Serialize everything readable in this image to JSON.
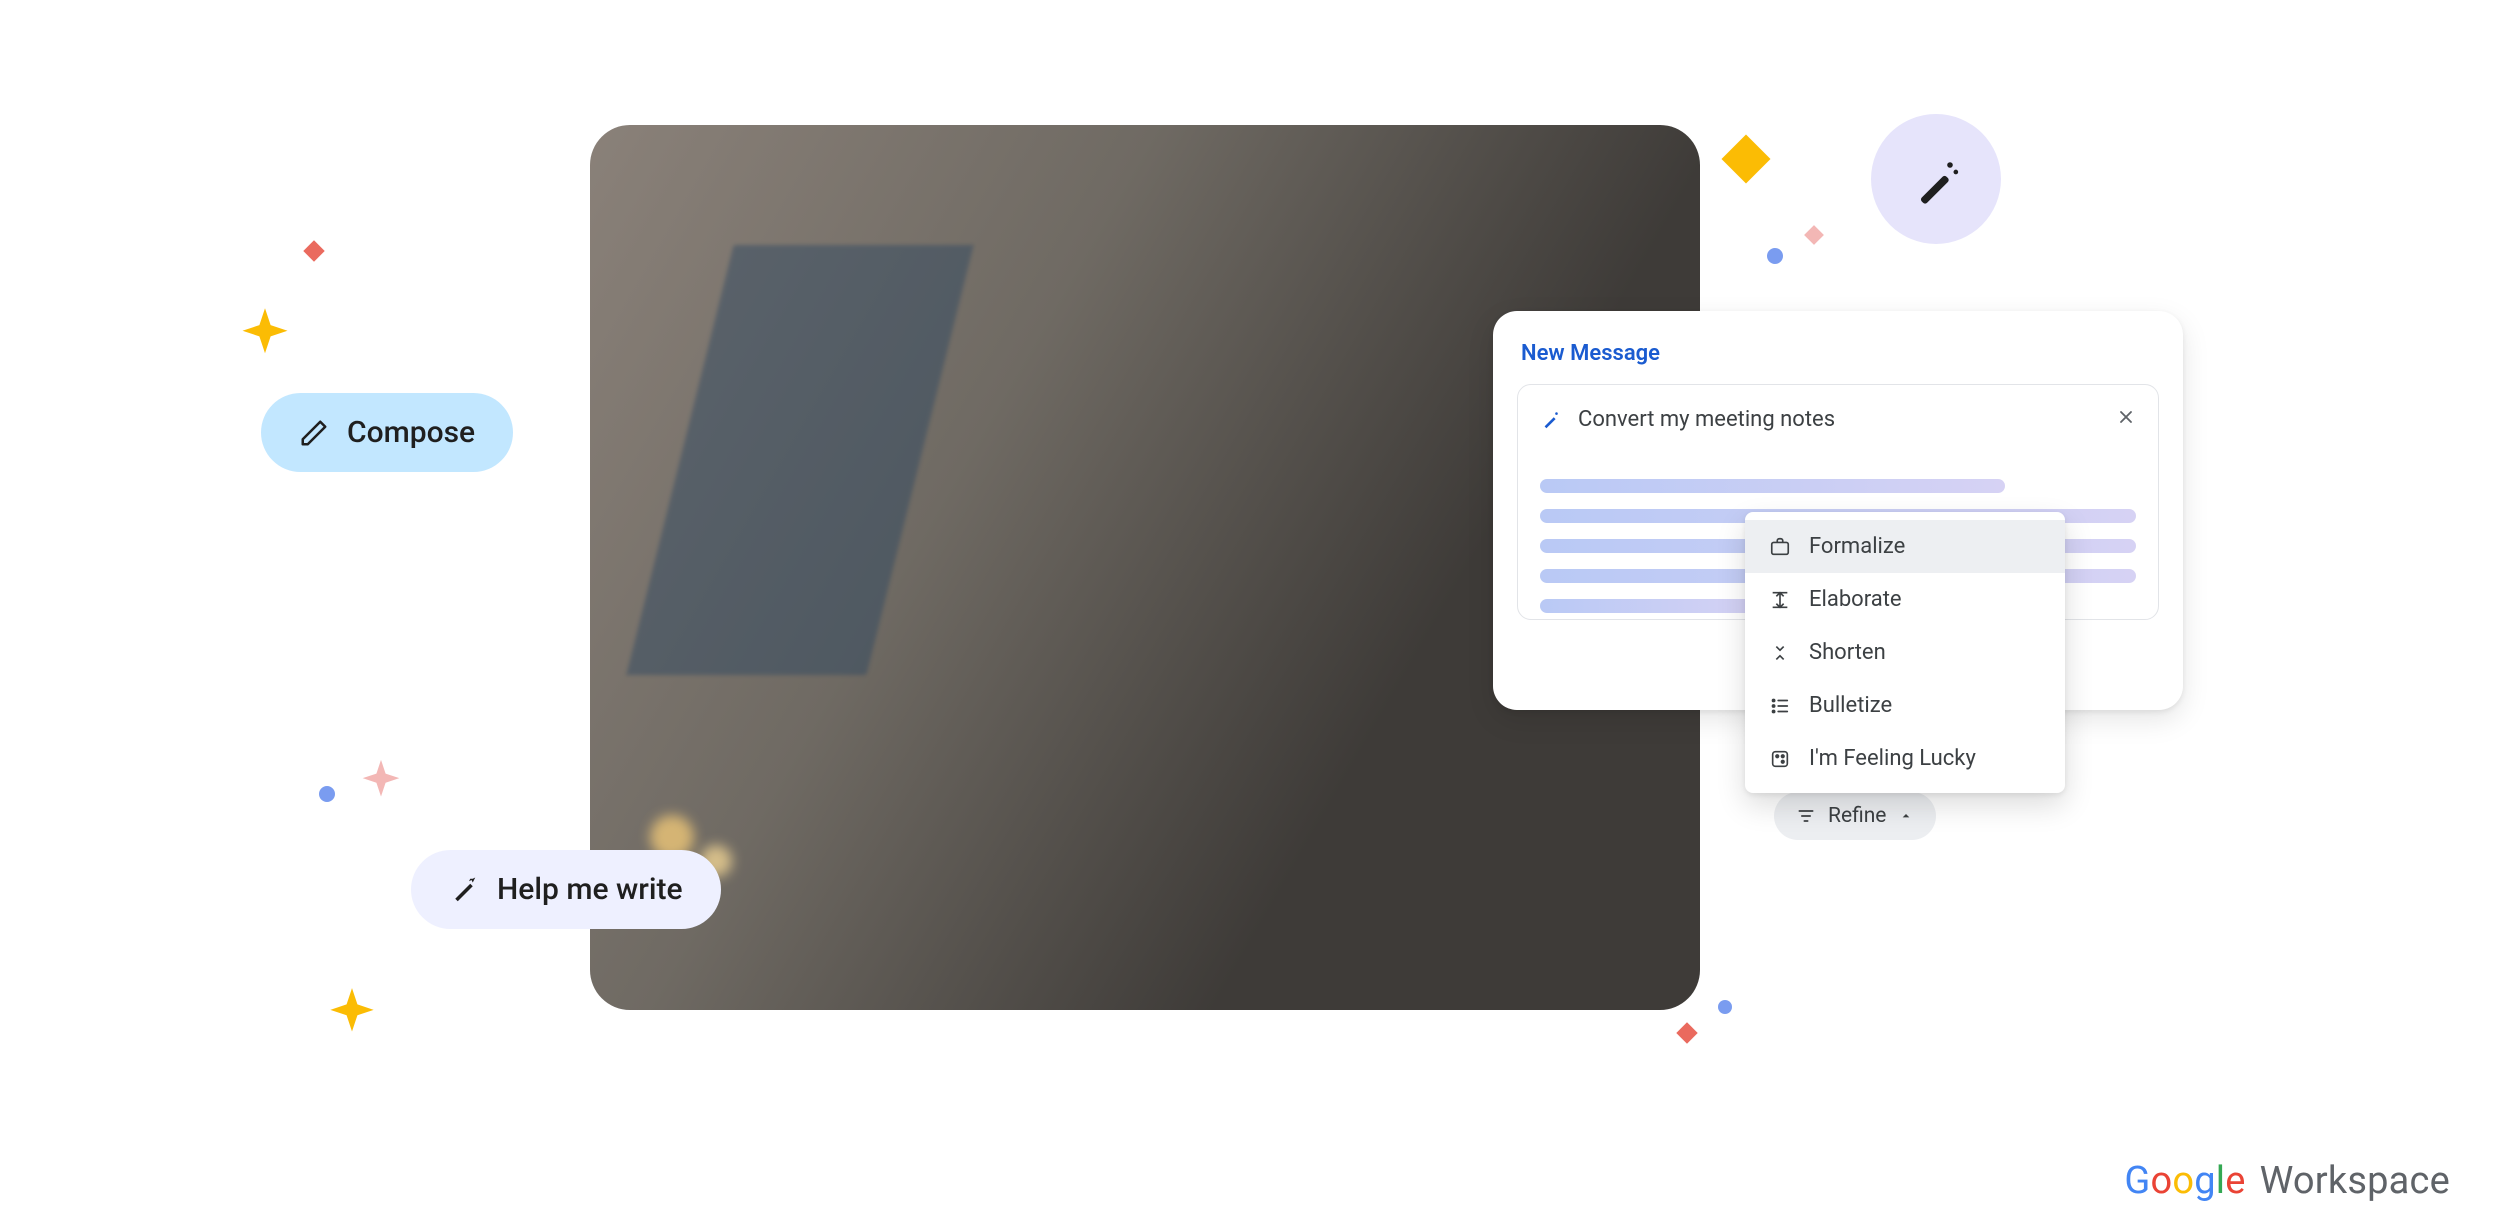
{
  "pills": {
    "compose_label": "Compose",
    "help_label": "Help me write"
  },
  "new_message": {
    "title": "New Message",
    "prompt_text": "Convert my meeting notes",
    "close_aria": "Close"
  },
  "refine": {
    "button_label": "Refine",
    "options": {
      "formalize": "Formalize",
      "elaborate": "Elaborate",
      "shorten": "Shorten",
      "bulletize": "Bulletize",
      "lucky": "I'm Feeling Lucky"
    }
  },
  "branding": {
    "workspace": "Workspace"
  }
}
